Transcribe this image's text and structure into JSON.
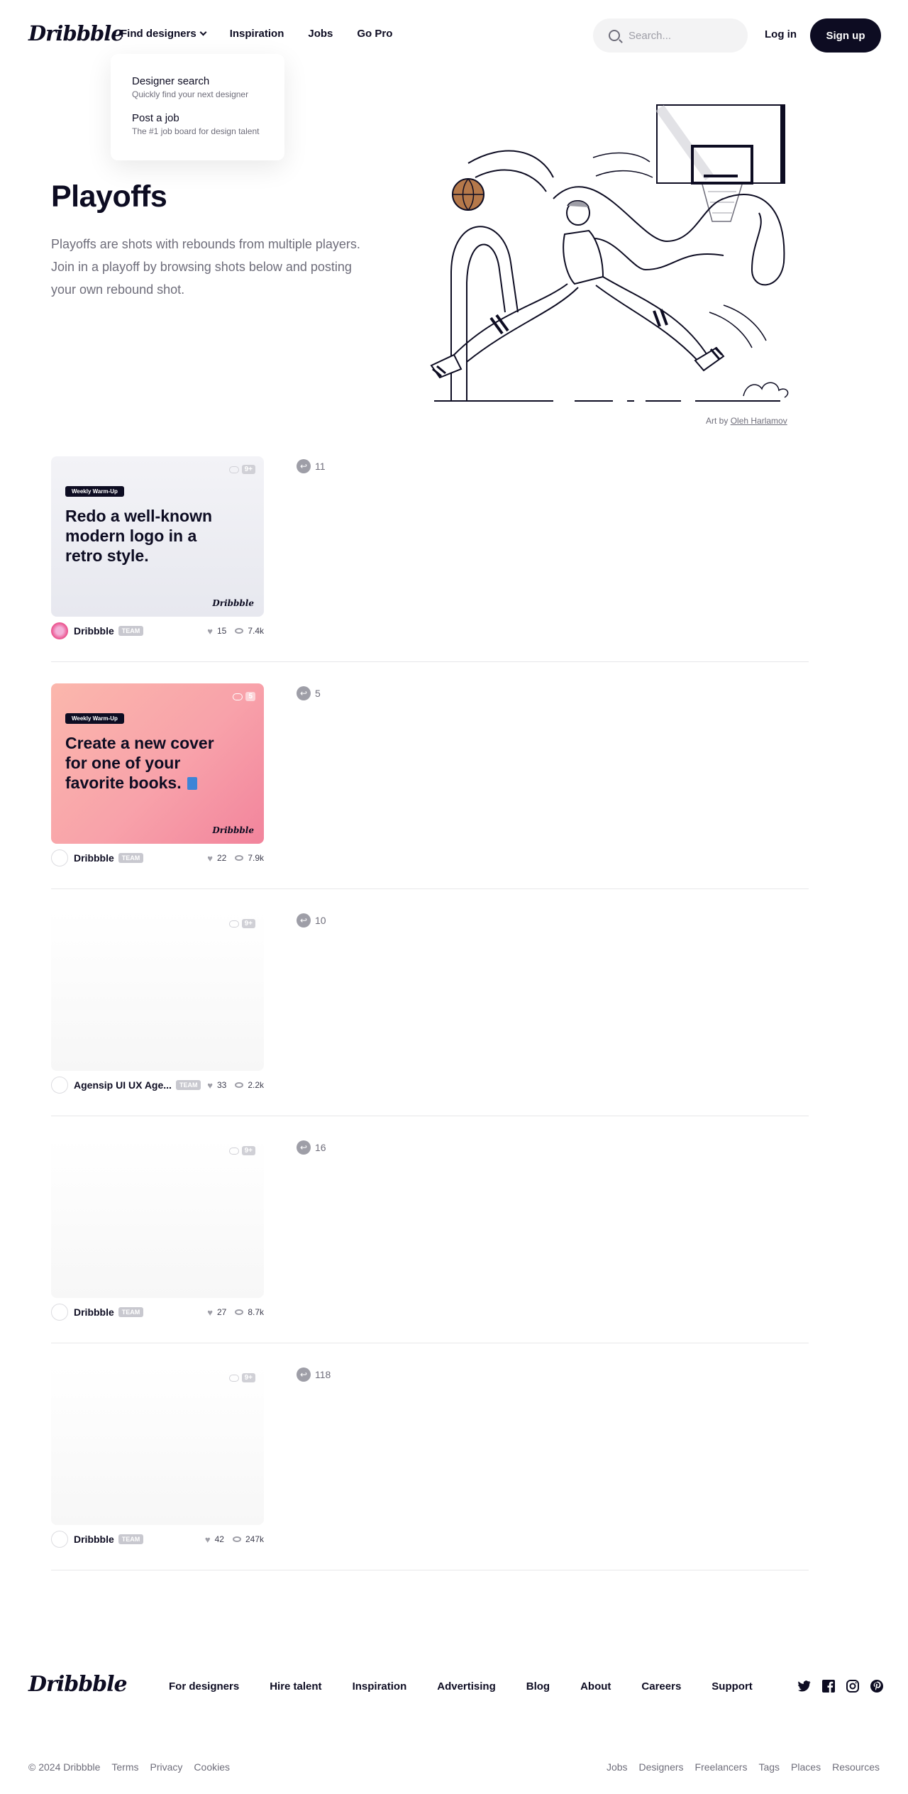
{
  "header": {
    "logo": "Dribbble",
    "nav": [
      "Find designers",
      "Inspiration",
      "Jobs",
      "Go Pro"
    ],
    "search_placeholder": "Search...",
    "login": "Log in",
    "signup": "Sign up"
  },
  "dropdown": [
    {
      "title": "Designer search",
      "sub": "Quickly find your next designer"
    },
    {
      "title": "Post a job",
      "sub": "The #1 job board for design talent"
    }
  ],
  "hero": {
    "title": "Playoffs",
    "description": "Playoffs are shots with rebounds from multiple players. Join in a playoff by browsing shots below and posting your own rebound shot.",
    "credit_prefix": "Art by",
    "credit_name": "Oleh Harlamov"
  },
  "playoffs": [
    {
      "tag": "Weekly Warm-Up",
      "title": "Redo a well-known modern logo in a retro style.",
      "badge": "9+",
      "author": "Dribbble",
      "team": "TEAM",
      "likes": "15",
      "views": "7.4k",
      "rebounds": "11",
      "style": "warm1",
      "shot_logo": "Dribbble"
    },
    {
      "tag": "Weekly Warm-Up",
      "title": "Create a new cover for one of your favorite books.",
      "badge": "5",
      "author": "Dribbble",
      "team": "TEAM",
      "likes": "22",
      "views": "7.9k",
      "rebounds": "5",
      "style": "warm2",
      "shot_logo": "Dribbble"
    },
    {
      "tag": "",
      "title": "",
      "badge": "9+",
      "author": "Agensip UI UX Age...",
      "team": "TEAM",
      "likes": "33",
      "views": "2.2k",
      "rebounds": "10",
      "style": "blank",
      "shot_logo": ""
    },
    {
      "tag": "",
      "title": "",
      "badge": "9+",
      "author": "Dribbble",
      "team": "TEAM",
      "likes": "27",
      "views": "8.7k",
      "rebounds": "16",
      "style": "blank",
      "shot_logo": ""
    },
    {
      "tag": "",
      "title": "",
      "badge": "9+",
      "author": "Dribbble",
      "team": "TEAM",
      "likes": "42",
      "views": "247k",
      "rebounds": "118",
      "style": "blank",
      "shot_logo": ""
    }
  ],
  "footer": {
    "logo": "Dribbble",
    "nav": [
      "For designers",
      "Hire talent",
      "Inspiration",
      "Advertising",
      "Blog",
      "About",
      "Careers",
      "Support"
    ],
    "social": [
      "twitter-icon",
      "facebook-icon",
      "instagram-icon",
      "pinterest-icon"
    ],
    "copyright": "© 2024 Dribbble",
    "legal": [
      "Terms",
      "Privacy",
      "Cookies"
    ],
    "links": [
      "Jobs",
      "Designers",
      "Freelancers",
      "Tags",
      "Places",
      "Resources"
    ]
  },
  "colors": {
    "brand_dark": "#0d0c22",
    "muted": "#6e6d7a",
    "accent_pink": "#ea4c89"
  }
}
